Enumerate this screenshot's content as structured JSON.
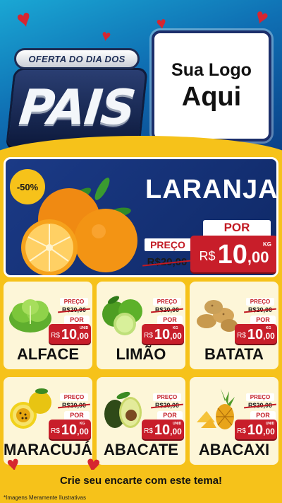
{
  "header": {
    "campaign_ribbon": "OFERTA DO DIA DOS",
    "campaign_word": "PAIS",
    "logo_line1": "Sua Logo",
    "logo_line2": "Aqui"
  },
  "hero": {
    "discount": "-50%",
    "name": "LARANJA",
    "preco_label": "PREÇO",
    "old_price": "R$20,00",
    "por_label": "POR",
    "currency": "R$",
    "price_int": "10",
    "price_dec": ",00",
    "unit": "KG"
  },
  "products": [
    {
      "name": "ALFACE",
      "preco_label": "PREÇO",
      "old_price": "R$20,00",
      "por_label": "POR",
      "currency": "R$",
      "price_int": "10",
      "price_dec": ",00",
      "unit": "UNID",
      "icon": "lettuce-icon"
    },
    {
      "name": "LIMÃO",
      "preco_label": "PREÇO",
      "old_price": "R$20,00",
      "por_label": "POR",
      "currency": "R$",
      "price_int": "10",
      "price_dec": ",00",
      "unit": "KG",
      "icon": "lime-icon"
    },
    {
      "name": "BATATA",
      "preco_label": "PREÇO",
      "old_price": "R$20,00",
      "por_label": "POR",
      "currency": "R$",
      "price_int": "10",
      "price_dec": ",00",
      "unit": "KG",
      "icon": "potato-icon"
    },
    {
      "name": "MARACUJÁ",
      "preco_label": "PREÇO",
      "old_price": "R$20,00",
      "por_label": "POR",
      "currency": "R$",
      "price_int": "10",
      "price_dec": ",00",
      "unit": "KG",
      "icon": "passion-fruit-icon"
    },
    {
      "name": "ABACATE",
      "preco_label": "PREÇO",
      "old_price": "R$20,00",
      "por_label": "POR",
      "currency": "R$",
      "price_int": "10",
      "price_dec": ",00",
      "unit": "UNID",
      "icon": "avocado-icon"
    },
    {
      "name": "ABACAXI",
      "preco_label": "PREÇO",
      "old_price": "R$20,00",
      "por_label": "POR",
      "currency": "R$",
      "price_int": "10",
      "price_dec": ",00",
      "unit": "UNID",
      "icon": "pineapple-icon"
    }
  ],
  "footer": {
    "cta": "Crie seu encarte com este tema!",
    "disclaimer": "*Imagens Meramente Ilustrativas"
  },
  "colors": {
    "accent_red": "#c81e2a",
    "brand_blue": "#1b3a86",
    "background_yellow": "#f6c21a",
    "card_cream": "#fdf6d8"
  }
}
